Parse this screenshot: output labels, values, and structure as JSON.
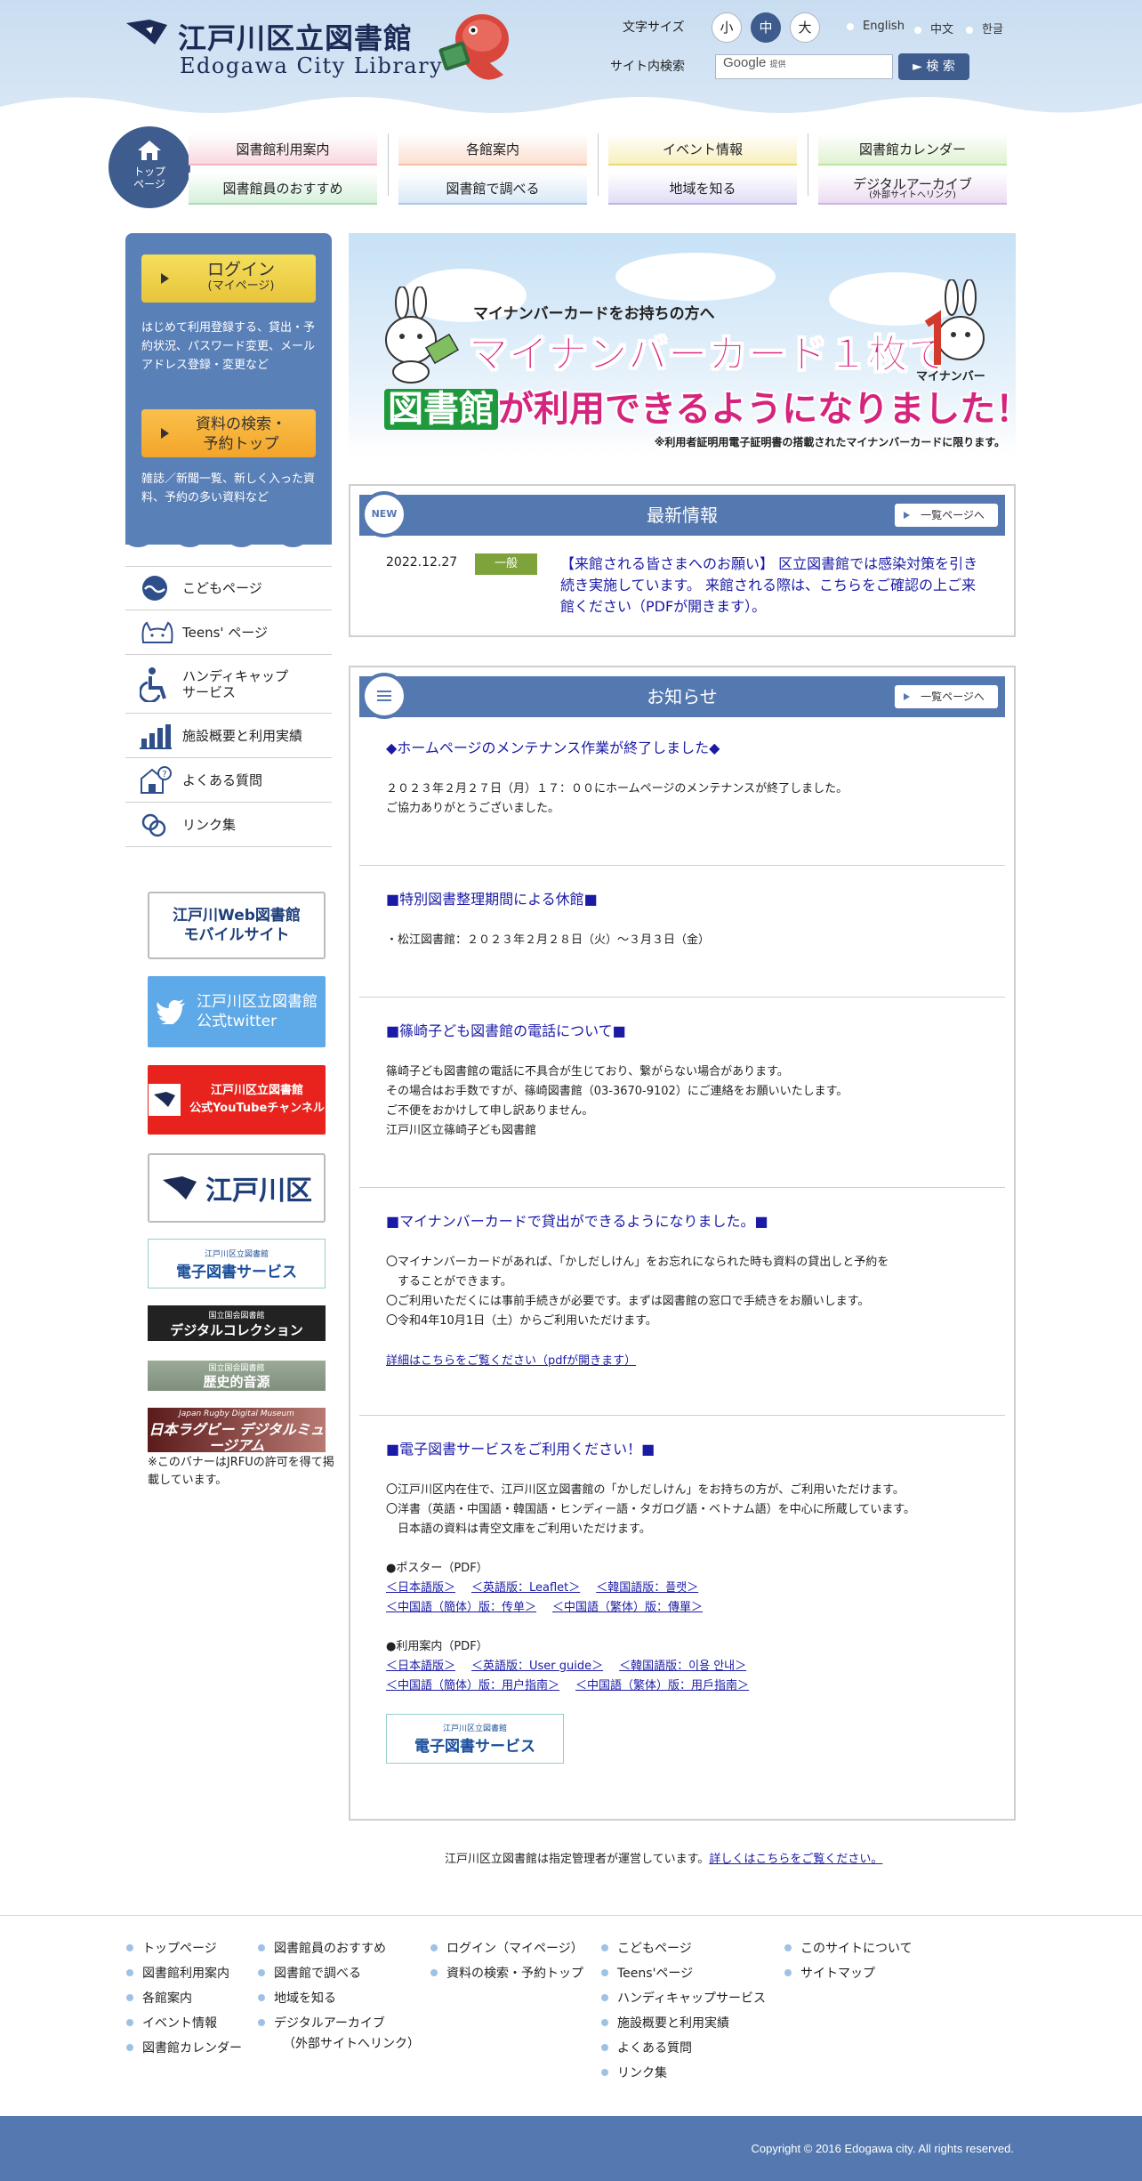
{
  "header": {
    "logo_jp": "江戸川区立図書館",
    "logo_en": "Edogawa City Library",
    "font_size_label": "文字サイズ",
    "font_sizes": [
      "小",
      "中",
      "大"
    ],
    "font_size_active": "中",
    "languages": [
      "English",
      "中文",
      "한글"
    ],
    "search_label": "サイト内検索",
    "search_placeholder_brand": "Google",
    "search_placeholder_suffix": "提供",
    "search_button": "検 索"
  },
  "global_nav": {
    "top": "トップページ",
    "top_line1": "トップ",
    "top_line2": "ページ",
    "items": [
      {
        "label": "図書館利用案内"
      },
      {
        "label": "図書館員のおすすめ"
      },
      {
        "label": "各館案内"
      },
      {
        "label": "図書館で調べる"
      },
      {
        "label": "イベント情報"
      },
      {
        "label": "地域を知る"
      },
      {
        "label": "図書館カレンダー"
      },
      {
        "label": "デジタルアーカイブ",
        "sub": "(外部サイトへリンク)"
      }
    ]
  },
  "sidebar": {
    "login": {
      "label": "ログイン",
      "sub": "(マイページ)",
      "desc": "はじめて利用登録する、貸出・予約状況、パスワード変更、メールアドレス登録・変更など"
    },
    "search": {
      "label1": "資料の検索・",
      "label2": "予約トップ",
      "desc": "雑誌／新聞一覧、新しく入った資料、予約の多い資料など"
    },
    "menu": [
      {
        "label": "こどもページ",
        "icon": "wave-fish-icon"
      },
      {
        "label": "Teens' ページ",
        "icon": "cat-icon"
      },
      {
        "label": "ハンディキャップ\nサービス",
        "icon": "wheelchair-icon"
      },
      {
        "label": "施設概要と利用実績",
        "icon": "bar-chart-icon"
      },
      {
        "label": "よくある質問",
        "icon": "question-icon"
      },
      {
        "label": "リンク集",
        "icon": "link-icon"
      }
    ],
    "banners": {
      "mobile": "江戸川Web図書館\nモバイルサイト",
      "twitter": "江戸川区立図書館\n公式twitter",
      "youtube": "江戸川区立図書館\n公式YouTubeチャンネル",
      "ward": "江戸川区",
      "ebook_small": "江戸川区立図書館",
      "ebook": "電子図書サービス",
      "ndl_small": "国立国会図書館",
      "ndl": "デジタルコレクション",
      "rekishi_small": "国立国会図書館",
      "rekishi": "歴史的音源",
      "rugby_small": "Japan Rugby Digital Museum",
      "rugby": "日本ラグビー デジタルミュージアム",
      "note": "※このバナーはJRFUの許可を得て掲載しています。"
    }
  },
  "hero": {
    "sub": "マイナンバーカードをお持ちの方へ",
    "line1": "マイナンバーカード１枚で",
    "line2_green": "図書館",
    "line2_rest": "が利用できるようになりました！",
    "mascot_label": "マイナンバー",
    "note": "※利用者証明用電子証明書の搭載されたマイナンバーカードに限ります。"
  },
  "latest": {
    "badge": "NEW",
    "title": "最新情報",
    "more": "一覧ページへ",
    "items": [
      {
        "date": "2022.12.27",
        "category": "一般",
        "title": "【来館される皆さまへのお願い】 区立図書館では感染対策を引き続き実施しています。 来館される際は、こちらをご確認の上ご来館ください（PDFが開きます）。"
      }
    ]
  },
  "notices": {
    "title": "お知らせ",
    "more": "一覧ページへ",
    "items": [
      {
        "title": "◆ホームページのメンテナンス作業が終了しました◆",
        "body": "２０２３年２月２７日（月）１７：００にホームページのメンテナンスが終了しました。\nご協力ありがとうございました。"
      },
      {
        "title": "■特別図書整理期間による休館■",
        "body": "・松江図書館：２０２３年２月２８日（火）〜３月３日（金）"
      },
      {
        "title": "■篠崎子ども図書館の電話について■",
        "body": "篠崎子ども図書館の電話に不具合が生じており、繋がらない場合があります。\nその場合はお手数ですが、篠崎図書館（03-3670-9102）にご連絡をお願いいたします。\nご不便をおかけして申し訳ありません。\n江戸川区立篠崎子ども図書館"
      },
      {
        "title": "■マイナンバーカードで貸出ができるようになりました。■",
        "body": "〇マイナンバーカードがあれば、「かしだしけん」をお忘れになられた時も資料の貸出しと予約を\n　することができます。\n〇ご利用いただくには事前手続きが必要です。まずは図書館の窓口で手続きをお願いします。\n〇令和4年10月1日（土）からご利用いただけます。",
        "link": "詳細はこちらをご覧ください（pdfが開きます）"
      },
      {
        "title": "■電子図書サービスをご利用ください！■",
        "body": "〇江戸川区内在住で、江戸川区立図書館の「かしだしけん」をお持ちの方が、ご利用いただけます。\n〇洋書（英語・中国語・韓国語・ヒンディー語・タガログ語・ベトナム語）を中心に所蔵しています。\n　日本語の資料は青空文庫をご利用いただけます。",
        "poster_label": "●ポスター（PDF）",
        "poster_links": [
          "＜日本語版＞",
          "＜英語版：Leaflet＞",
          "＜韓国語版：플랫＞",
          "＜中国語（簡体）版：传单＞",
          "＜中国語（繁体）版：傳單＞"
        ],
        "guide_label": "●利用案内（PDF）",
        "guide_links": [
          "＜日本語版＞",
          "＜英語版：User guide＞",
          "＜韓国語版：이용 안내＞",
          "＜中国語（簡体）版：用户指南＞",
          "＜中国語（繁体）版：用戶指南＞"
        ],
        "banner_small": "江戸川区立図書館",
        "banner": "電子図書サービス"
      }
    ]
  },
  "management": {
    "text": "江戸川区立図書館は指定管理者が運営しています。",
    "link": "詳しくはこちらをご覧ください。"
  },
  "footer": {
    "col1": [
      "トップページ",
      "図書館利用案内",
      "各館案内",
      "イベント情報",
      "図書館カレンダー"
    ],
    "col2": [
      "図書館員のおすすめ",
      "図書館で調べる",
      "地域を知る",
      "デジタルアーカイブ"
    ],
    "col2_sub": "（外部サイトへリンク）",
    "col3": [
      "ログイン（マイページ）",
      "資料の検索・予約トップ"
    ],
    "col4": [
      "こどもページ",
      "Teens'ページ",
      "ハンディキャップサービス",
      "施設概要と利用実績",
      "よくある質問",
      "リンク集"
    ],
    "col5": [
      "このサイトについて",
      "サイトマップ"
    ],
    "copyright": "Copyright © 2016 Edogawa city. All rights reserved."
  },
  "colors": {
    "primary": "#5478b0",
    "header_bg": "#c9ddf1",
    "accent_pink": "#d5247d",
    "link": "#1a1aa6"
  }
}
